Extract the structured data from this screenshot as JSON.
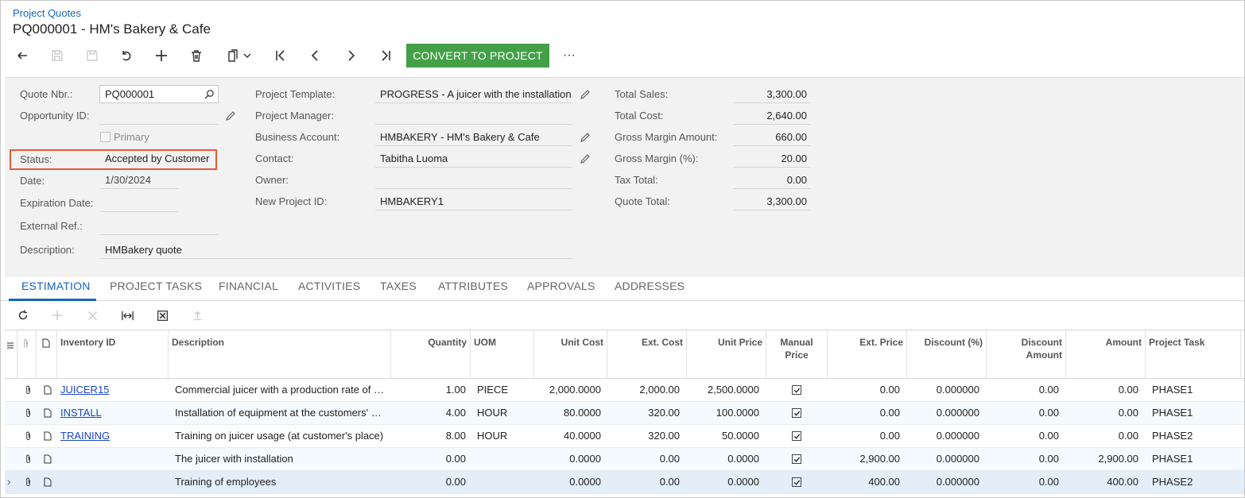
{
  "header": {
    "breadcrumb": "Project Quotes",
    "title": "PQ000001 - HM's Bakery & Cafe",
    "convert_label": "CONVERT TO PROJECT",
    "more_label": "···"
  },
  "form": {
    "col1": {
      "quote_nbr_label": "Quote Nbr.:",
      "quote_nbr": "PQ000001",
      "opportunity_label": "Opportunity ID:",
      "opportunity": "",
      "primary_label": "Primary",
      "status_label": "Status:",
      "status": "Accepted by Customer",
      "date_label": "Date:",
      "date": "1/30/2024",
      "expiration_label": "Expiration Date:",
      "expiration": "",
      "external_ref_label": "External Ref.:",
      "external_ref": "",
      "description_label": "Description:",
      "description": "HMBakery quote"
    },
    "col2": {
      "template_label": "Project Template:",
      "template": "PROGRESS - A juicer with the installation",
      "manager_label": "Project Manager:",
      "manager": "",
      "business_label": "Business Account:",
      "business": "HMBAKERY - HM's Bakery & Cafe",
      "contact_label": "Contact:",
      "contact": "Tabitha Luoma",
      "owner_label": "Owner:",
      "owner": "",
      "new_project_label": "New Project ID:",
      "new_project": "HMBAKERY1"
    },
    "col3": {
      "total_sales_label": "Total Sales:",
      "total_sales": "3,300.00",
      "total_cost_label": "Total Cost:",
      "total_cost": "2,640.00",
      "gm_amount_label": "Gross Margin Amount:",
      "gm_amount": "660.00",
      "gm_pct_label": "Gross Margin (%):",
      "gm_pct": "20.00",
      "tax_total_label": "Tax Total:",
      "tax_total": "0.00",
      "quote_total_label": "Quote Total:",
      "quote_total": "3,300.00"
    }
  },
  "tabs": [
    "ESTIMATION",
    "PROJECT TASKS",
    "FINANCIAL",
    "ACTIVITIES",
    "TAXES",
    "ATTRIBUTES",
    "APPROVALS",
    "ADDRESSES"
  ],
  "grid": {
    "headers": {
      "inventory": "Inventory ID",
      "description": "Description",
      "quantity": "Quantity",
      "uom": "UOM",
      "unit_cost": "Unit Cost",
      "ext_cost": "Ext. Cost",
      "unit_price": "Unit Price",
      "manual_price": "Manual Price",
      "ext_price": "Ext. Price",
      "discount_pct": "Discount (%)",
      "discount_amount": "Discount Amount",
      "amount": "Amount",
      "project_task": "Project Task"
    },
    "rows": [
      {
        "inventory": "JUICER15",
        "description": "Commercial juicer with a production rate of …",
        "quantity": "1.00",
        "uom": "PIECE",
        "unit_cost": "2,000.0000",
        "ext_cost": "2,000.00",
        "unit_price": "2,500.0000",
        "manual_price": true,
        "ext_price": "0.00",
        "discount_pct": "0.000000",
        "discount_amount": "0.00",
        "amount": "0.00",
        "project_task": "PHASE1"
      },
      {
        "inventory": "INSTALL",
        "description": "Installation of equipment at the customers' …",
        "quantity": "4.00",
        "uom": "HOUR",
        "unit_cost": "80.0000",
        "ext_cost": "320.00",
        "unit_price": "100.0000",
        "manual_price": true,
        "ext_price": "0.00",
        "discount_pct": "0.000000",
        "discount_amount": "0.00",
        "amount": "0.00",
        "project_task": "PHASE1"
      },
      {
        "inventory": "TRAINING",
        "description": "Training on juicer usage (at customer's place)",
        "quantity": "8.00",
        "uom": "HOUR",
        "unit_cost": "40.0000",
        "ext_cost": "320.00",
        "unit_price": "50.0000",
        "manual_price": true,
        "ext_price": "0.00",
        "discount_pct": "0.000000",
        "discount_amount": "0.00",
        "amount": "0.00",
        "project_task": "PHASE2"
      },
      {
        "inventory": "",
        "description": "The juicer with installation",
        "quantity": "0.00",
        "uom": "",
        "unit_cost": "0.0000",
        "ext_cost": "0.00",
        "unit_price": "0.0000",
        "manual_price": true,
        "ext_price": "2,900.00",
        "discount_pct": "0.000000",
        "discount_amount": "0.00",
        "amount": "2,900.00",
        "project_task": "PHASE1"
      },
      {
        "inventory": "",
        "description": "Training of employees",
        "quantity": "0.00",
        "uom": "",
        "unit_cost": "0.0000",
        "ext_cost": "0.00",
        "unit_price": "0.0000",
        "manual_price": true,
        "ext_price": "400.00",
        "discount_pct": "0.000000",
        "discount_amount": "0.00",
        "amount": "400.00",
        "project_task": "PHASE2"
      }
    ]
  },
  "colors": {
    "accent": "#1565c0",
    "convert_button": "#43a047",
    "status_highlight": "#e05a38",
    "link": "#1a47c8"
  }
}
